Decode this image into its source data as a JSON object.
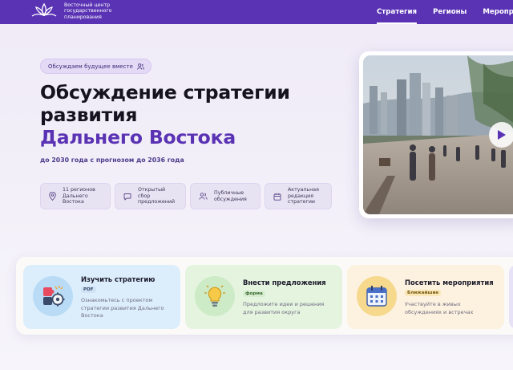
{
  "header": {
    "logo_lines": [
      "Восточный центр",
      "государственного",
      "планирования"
    ],
    "nav": [
      {
        "label": "Стратегия",
        "active": true
      },
      {
        "label": "Регионы",
        "active": false
      },
      {
        "label": "Мероприятия",
        "active": false
      }
    ]
  },
  "hero": {
    "badge": "Обсуждаем будущее вместе",
    "title_line1": "Обсуждение стратегии",
    "title_line2": "развития",
    "title_accent": "Дальнего Востока",
    "subtitle": "до 2030 года с прогнозом до 2036 года",
    "features": [
      {
        "icon": "location-pin-icon",
        "lines": [
          "11 регионов",
          "Дальнего",
          "Востока"
        ]
      },
      {
        "icon": "chat-bubble-icon",
        "lines": [
          "Открытый",
          "сбор",
          "предложений"
        ]
      },
      {
        "icon": "people-icon",
        "lines": [
          "Публичные",
          "обсуждения"
        ]
      },
      {
        "icon": "calendar-icon",
        "lines": [
          "Актуальная",
          "редакция",
          "стратегии"
        ]
      }
    ],
    "video_icon": "play-icon"
  },
  "cards": [
    {
      "title": "Изучить стратегию",
      "tag": "PDF",
      "desc_lines": [
        "Ознакомьтесь с проектом",
        "стратегии развития Дальнего",
        "Востока"
      ],
      "icon": "puzzle-gear-icon"
    },
    {
      "title": "Внести предложения",
      "tag": "форма",
      "desc_lines": [
        "Предложите идеи и решения",
        "для развития округа"
      ],
      "icon": "lightbulb-icon"
    },
    {
      "title": "Посетить мероприятия",
      "tag": "Ближайшие",
      "desc_lines": [
        "Участвуйте в живых",
        "обсуждениях и встречах"
      ],
      "icon": "calendar-icon"
    }
  ],
  "colors": {
    "brand": "#5a33b4",
    "accent_text": "#5a33b4"
  }
}
